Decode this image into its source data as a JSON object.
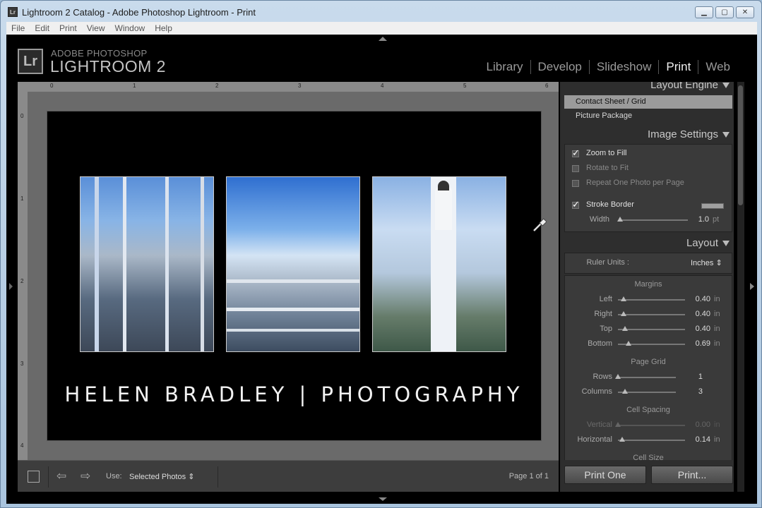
{
  "window": {
    "icon_text": "Lr",
    "title": "Lightroom 2 Catalog - Adobe Photoshop Lightroom - Print",
    "buttons": [
      "minimize",
      "maximize",
      "close"
    ]
  },
  "menubar": [
    "File",
    "Edit",
    "Print",
    "View",
    "Window",
    "Help"
  ],
  "brand": {
    "logo": "Lr",
    "top": "ADOBE PHOTOSHOP",
    "main": "LIGHTROOM 2"
  },
  "modules": [
    "Library",
    "Develop",
    "Slideshow",
    "Print",
    "Web"
  ],
  "active_module": "Print",
  "ruler": {
    "top_labels": [
      "0",
      "1",
      "2",
      "3",
      "4",
      "5",
      "6"
    ],
    "left_labels": [
      "0",
      "1",
      "2",
      "3",
      "4"
    ]
  },
  "page": {
    "text": "HELEN BRADLEY | PHOTOGRAPHY",
    "background": "#000000"
  },
  "toolbar": {
    "use_label": "Use:",
    "use_value": "Selected Photos",
    "page_info": "Page 1 of 1"
  },
  "panel": {
    "layout_engine": {
      "title": "Layout Engine",
      "items": [
        "Contact Sheet / Grid",
        "Picture Package"
      ],
      "selected": "Contact Sheet / Grid"
    },
    "image_settings": {
      "title": "Image Settings",
      "zoom_to_fill": {
        "label": "Zoom to Fill",
        "checked": true
      },
      "rotate_to_fit": {
        "label": "Rotate to Fit",
        "checked": false
      },
      "repeat_one": {
        "label": "Repeat One Photo per Page",
        "checked": false
      },
      "stroke_border": {
        "label": "Stroke Border",
        "checked": true
      },
      "width": {
        "label": "Width",
        "value": "1.0",
        "unit": "pt",
        "fraction": 0.02
      }
    },
    "layout": {
      "title": "Layout",
      "ruler_units_label": "Ruler Units :",
      "ruler_units_value": "Inches",
      "margins_title": "Margins",
      "margins": [
        {
          "label": "Left",
          "value": "0.40",
          "unit": "in",
          "fraction": 0.08
        },
        {
          "label": "Right",
          "value": "0.40",
          "unit": "in",
          "fraction": 0.08
        },
        {
          "label": "Top",
          "value": "0.40",
          "unit": "in",
          "fraction": 0.1
        },
        {
          "label": "Bottom",
          "value": "0.69",
          "unit": "in",
          "fraction": 0.16
        }
      ],
      "page_grid_title": "Page Grid",
      "grid": [
        {
          "label": "Rows",
          "value": "1",
          "fraction": 0.0
        },
        {
          "label": "Columns",
          "value": "3",
          "fraction": 0.12
        }
      ],
      "cell_spacing_title": "Cell Spacing",
      "spacing": [
        {
          "label": "Vertical",
          "value": "0.00",
          "unit": "in",
          "fraction": 0.0,
          "disabled": true
        },
        {
          "label": "Horizontal",
          "value": "0.14",
          "unit": "in",
          "fraction": 0.06,
          "disabled": false
        }
      ],
      "cell_size_title": "Cell Size"
    }
  },
  "footer": {
    "print_one": "Print One",
    "print": "Print..."
  },
  "colors": {
    "page_bg": "#000000",
    "panel_bg": "#2e2e2e",
    "active_module": "#f0f0f0"
  }
}
